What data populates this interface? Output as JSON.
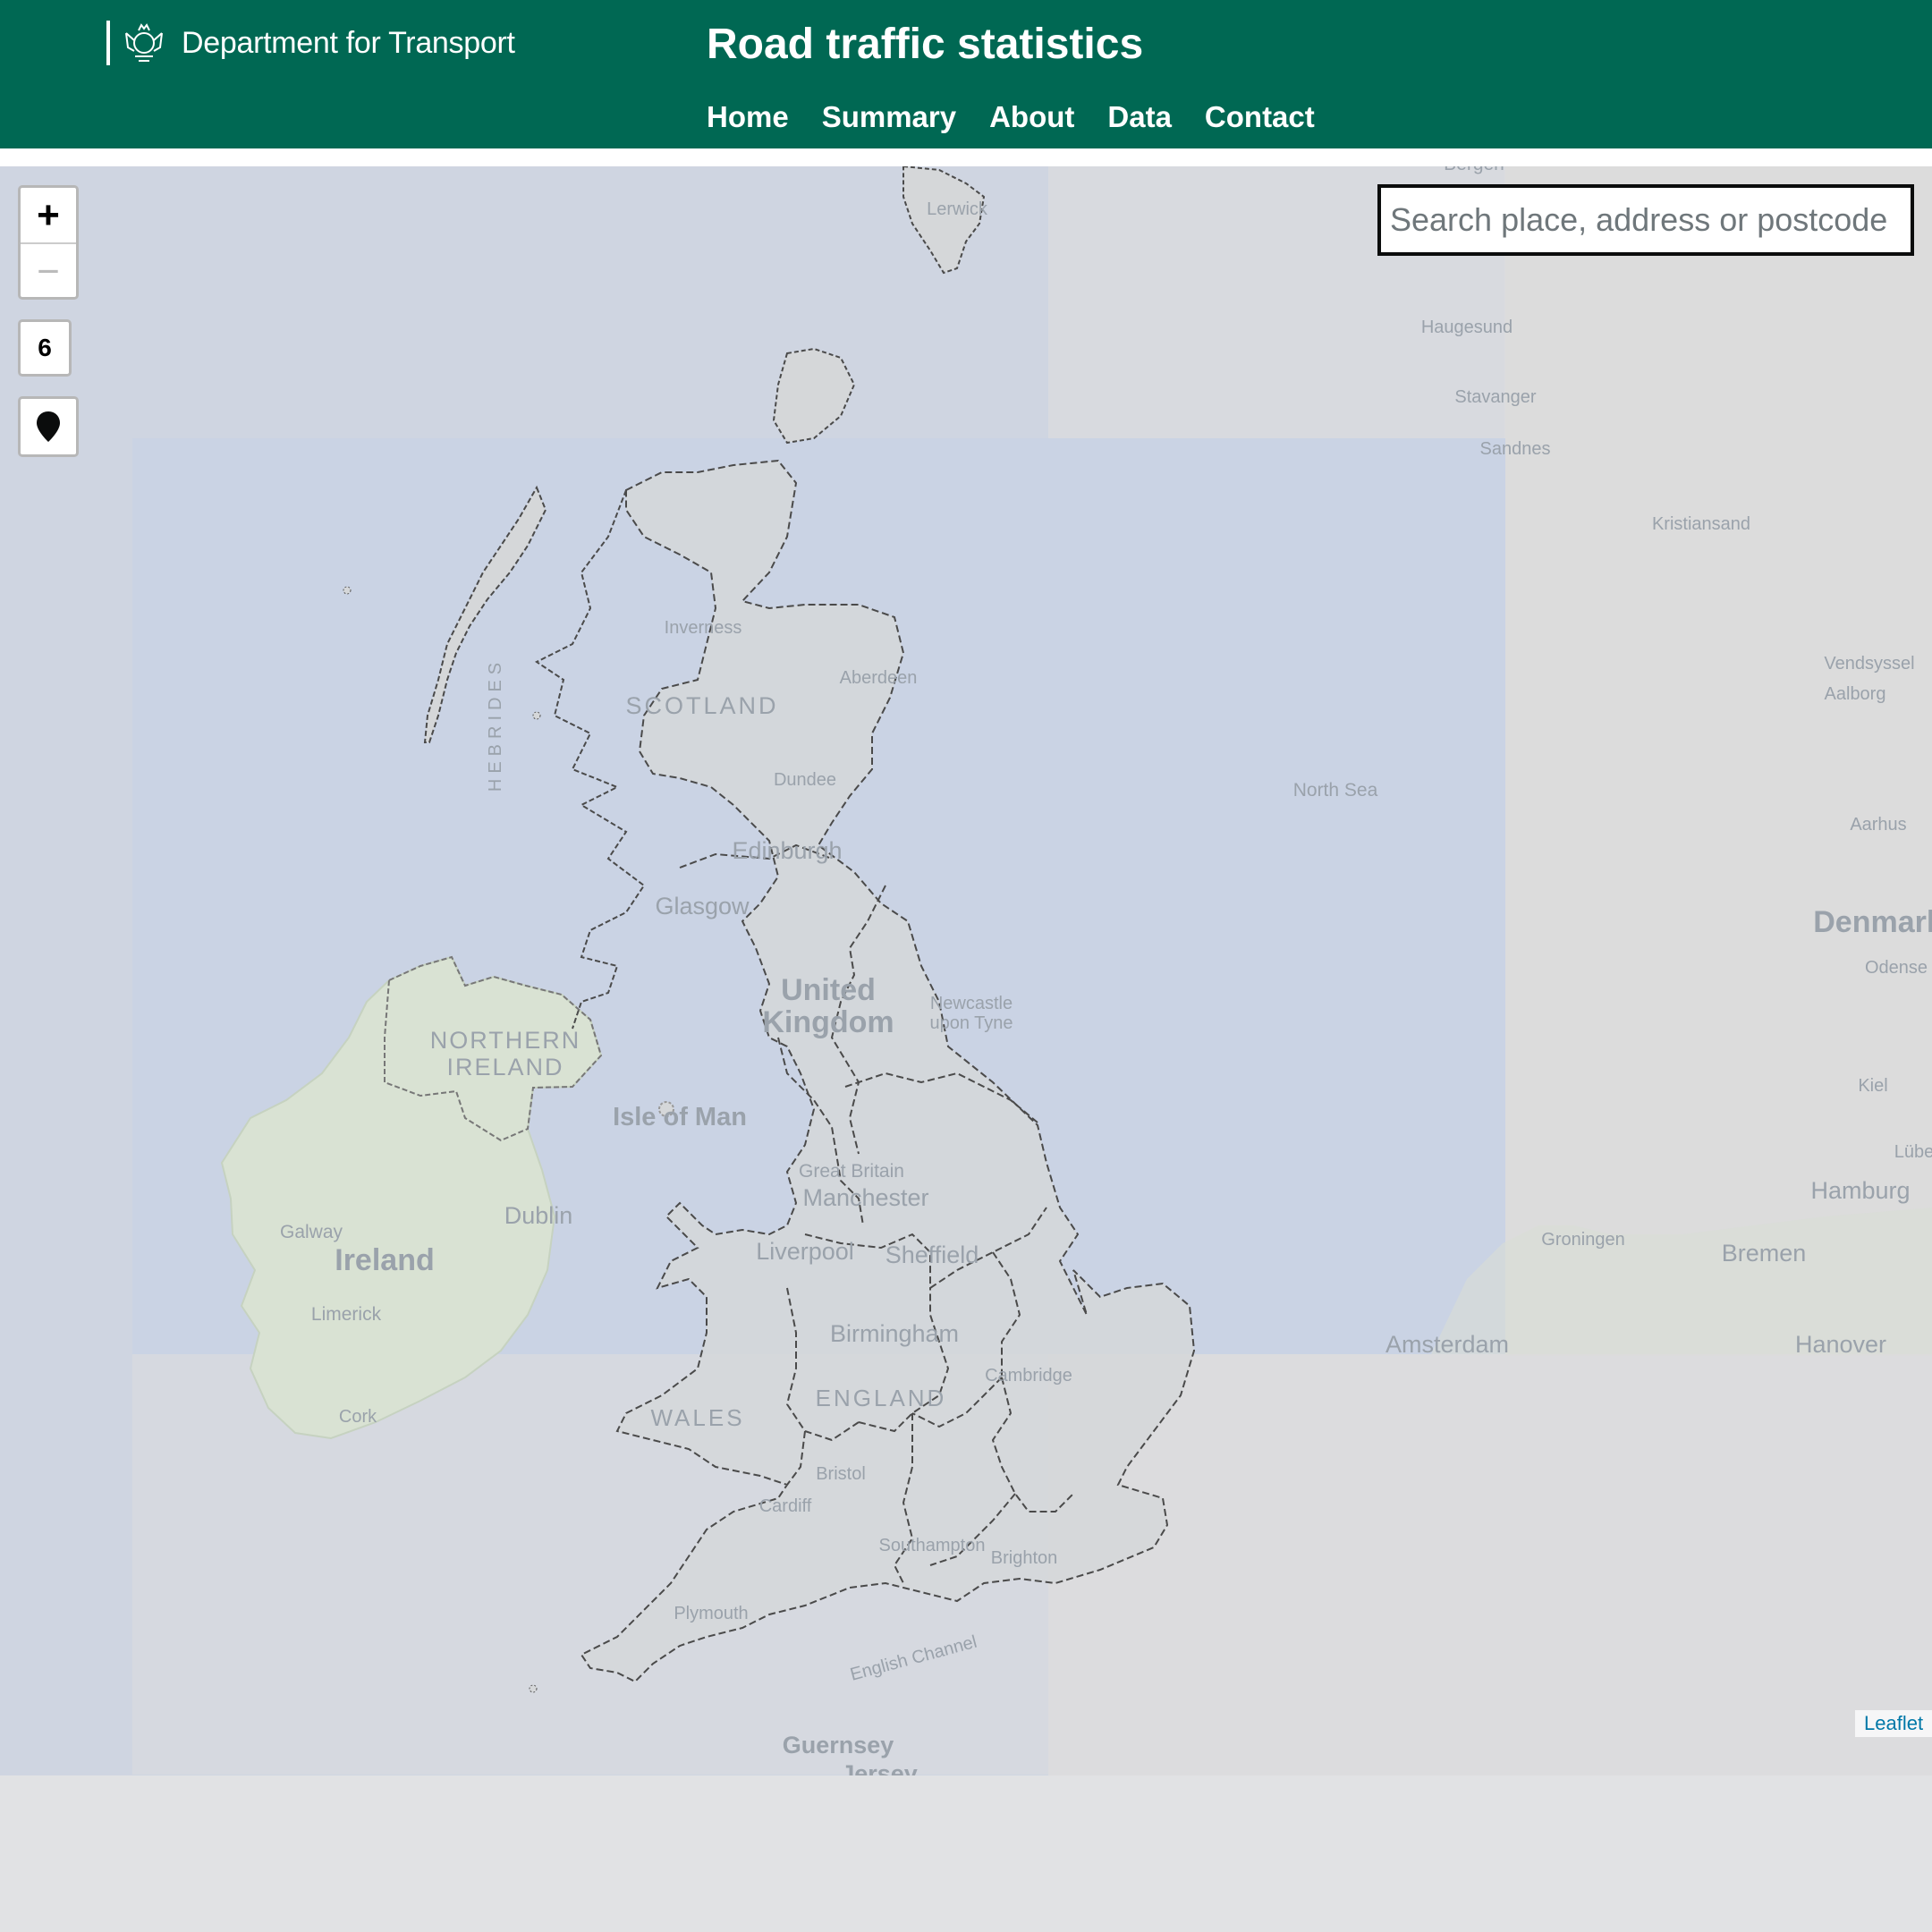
{
  "header": {
    "department": "Department for Transport",
    "title": "Road traffic statistics",
    "nav": [
      "Home",
      "Summary",
      "About",
      "Data",
      "Contact"
    ]
  },
  "map": {
    "search_placeholder": "Search place, address or postcode",
    "zoom_in": "+",
    "zoom_out": "−",
    "zoom_level": "6",
    "attribution": "Leaflet",
    "labels": {
      "scotland": "SCOTLAND",
      "hebrides": "HEBRIDES",
      "northern_ireland_1": "NORTHERN",
      "northern_ireland_2": "IRELAND",
      "ireland": "Ireland",
      "isle_of_man": "Isle of Man",
      "united_kingdom_1": "United",
      "united_kingdom_2": "Kingdom",
      "wales": "WALES",
      "england": "ENGLAND",
      "great_britain": "Great Britain",
      "north_sea": "North Sea",
      "english_channel": "English Channel",
      "denmark": "Denmark",
      "inverness": "Inverness",
      "aberdeen": "Aberdeen",
      "dundee": "Dundee",
      "edinburgh": "Edinburgh",
      "glasgow": "Glasgow",
      "newcastle_1": "Newcastle",
      "newcastle_2": "upon Tyne",
      "manchester": "Manchester",
      "liverpool": "Liverpool",
      "sheffield": "Sheffield",
      "birmingham": "Birmingham",
      "bristol": "Bristol",
      "cardiff": "Cardiff",
      "southampton": "Southampton",
      "brighton": "Brighton",
      "plymouth": "Plymouth",
      "cambridge": "Cambridge",
      "guernsey": "Guernsey",
      "jersey": "Jersey",
      "dublin": "Dublin",
      "galway": "Galway",
      "limerick": "Limerick",
      "cork": "Cork",
      "lerwick": "Lerwick",
      "bergen": "Bergen",
      "haugesund": "Haugesund",
      "stavanger": "Stavanger",
      "sandnes": "Sandnes",
      "kristiansand": "Kristiansand",
      "vendsyssel": "Vendsyssel",
      "aalborg": "Aalborg",
      "aarhus": "Aarhus",
      "odense": "Odense",
      "kiel": "Kiel",
      "lubeck": "Lübeck",
      "hamburg": "Hamburg",
      "bremen": "Bremen",
      "groningen": "Groningen",
      "amsterdam": "Amsterdam",
      "hanover": "Hanover"
    }
  }
}
